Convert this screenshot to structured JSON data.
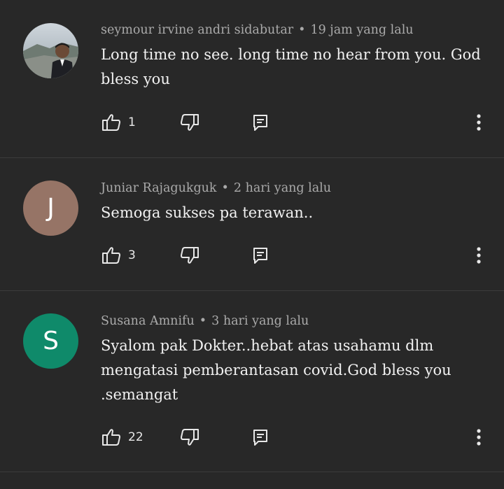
{
  "colors": {
    "background": "#282828",
    "divider": "#3c3c3c",
    "text_primary": "#f1f1f1",
    "text_secondary": "#aaaaaa",
    "avatar_j": "#967466",
    "avatar_s": "#0f8a6a"
  },
  "comments": [
    {
      "author": "seymour irvine andri sidabutar",
      "separator": "•",
      "time": "19 jam yang lalu",
      "text": "Long time no see. long time no hear from you. God bless you",
      "likes": "1",
      "avatar_type": "photo"
    },
    {
      "author": "Juniar Rajagukguk",
      "separator": "•",
      "time": "2 hari yang lalu",
      "text": "Semoga sukses pa terawan..",
      "likes": "3",
      "avatar_letter": "J"
    },
    {
      "author": "Susana Amnifu",
      "separator": "•",
      "time": "3 hari yang lalu",
      "text": "Syalom pak Dokter..hebat atas usahamu dlm mengatasi pemberantasan covid.God bless you .semangat",
      "likes": "22",
      "avatar_letter": "S"
    }
  ],
  "icons": {
    "like": "thumbs-up-icon",
    "dislike": "thumbs-down-icon",
    "reply": "reply-icon",
    "more": "more-vertical-icon"
  }
}
